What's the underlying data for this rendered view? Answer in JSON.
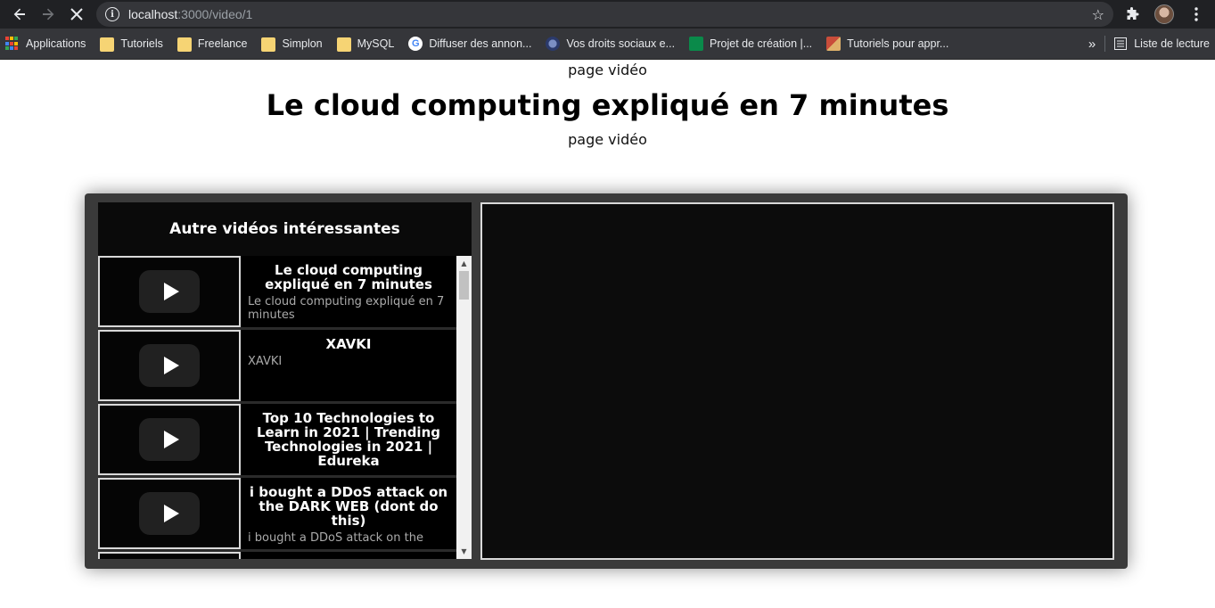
{
  "browser": {
    "url_host": "localhost",
    "url_path": ":3000/video/1",
    "bookmarks": [
      {
        "label": "Applications",
        "icon": "apps-grid-icon"
      },
      {
        "label": "Tutoriels",
        "icon": "folder-icon"
      },
      {
        "label": "Freelance",
        "icon": "folder-icon"
      },
      {
        "label": "Simplon",
        "icon": "folder-icon"
      },
      {
        "label": "MySQL",
        "icon": "folder-icon"
      },
      {
        "label": "Diffuser des annon...",
        "icon": "google-icon"
      },
      {
        "label": "Vos droits sociaux e...",
        "icon": "site-icon"
      },
      {
        "label": "Projet de création |...",
        "icon": "bank-icon"
      },
      {
        "label": "Tutoriels pour appr...",
        "icon": "tutorial-icon"
      }
    ],
    "overflow": "»",
    "reading_list": "Liste de lecture"
  },
  "page": {
    "label_top": "page vidéo",
    "title": "Le cloud computing expliqué en 7 minutes",
    "label_bottom": "page vidéo"
  },
  "sidebar": {
    "title": "Autre vidéos intéressantes",
    "videos": [
      {
        "title": "Le cloud computing expliqué en 7 minutes",
        "description": "Le cloud computing expliqué en 7 minutes"
      },
      {
        "title": "XAVKI",
        "description": "XAVKI"
      },
      {
        "title": "Top 10 Technologies to Learn in 2021 | Trending Technologies in 2021 | Edureka",
        "description": ""
      },
      {
        "title": "i bought a DDoS attack on the DARK WEB (dont do this)",
        "description": "i bought a DDoS attack on the"
      }
    ]
  },
  "colors": {
    "chrome_bg": "#202124",
    "bookmark_bg": "#35363a",
    "player_shell": "#3a3a3a",
    "folder": "#f6d474"
  }
}
